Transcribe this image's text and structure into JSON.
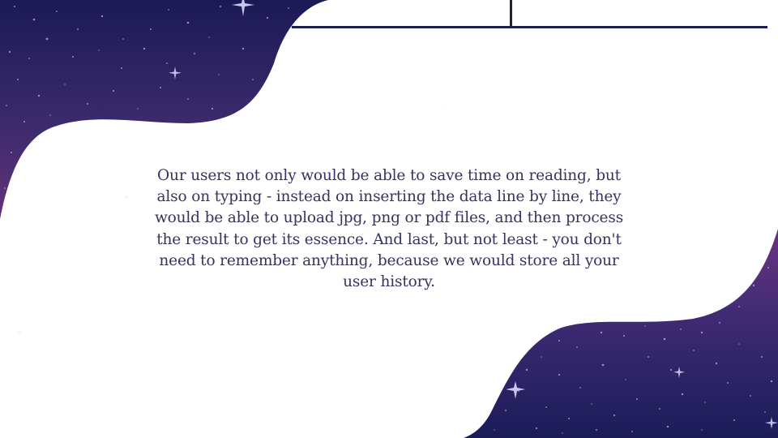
{
  "slide": {
    "body_text": "Our users not only would be able to save time on reading, but also on typing - instead on inserting the data line by line, they would be able to upload jpg, png or pdf files, and then process the result to get its essence. And last, but not least - you don't need to remember anything, because we would store all your user history."
  },
  "theme": {
    "background": "#ffffff",
    "space_dark": "#1c1c56",
    "space_purple": "#5a2f78",
    "rule_color": "#1f1f4d",
    "text_color": "#34345f"
  }
}
